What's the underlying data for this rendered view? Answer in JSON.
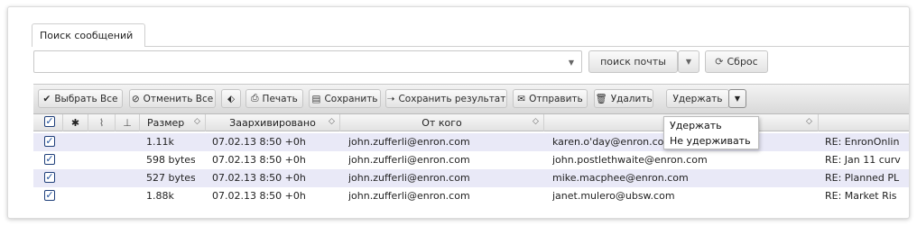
{
  "tab": {
    "label": "Поиск сообщений"
  },
  "search": {
    "value": "",
    "search_button": "поиск почты",
    "reset_button": "Сброс"
  },
  "toolbar": {
    "select_all": "Выбрать Все",
    "deselect_all": "Отменить Все",
    "print": "Печать",
    "save": "Сохранить",
    "save_result": "Сохранить результат",
    "send": "Отправить",
    "delete": "Удалить",
    "hold": "Удержать"
  },
  "dropdown": {
    "items": [
      "Удержать",
      "Не удерживать"
    ]
  },
  "columns": {
    "size": "Размер",
    "archived": "Заархивировано",
    "from": "От кого"
  },
  "rows": [
    {
      "size": "1.11k",
      "archived": "07.02.13 8:50 +0h",
      "from": "john.zufferli@enron.com",
      "to": "karen.o'day@enron.com",
      "subject": "RE: EnronOnlin",
      "checked": true
    },
    {
      "size": "598 bytes",
      "archived": "07.02.13 8:50 +0h",
      "from": "john.zufferli@enron.com",
      "to": "john.postlethwaite@enron.com",
      "subject": "RE: Jan 11 curv",
      "checked": true
    },
    {
      "size": "527 bytes",
      "archived": "07.02.13 8:50 +0h",
      "from": "john.zufferli@enron.com",
      "to": "mike.macphee@enron.com",
      "subject": "RE: Planned PL",
      "checked": true
    },
    {
      "size": "1.88k",
      "archived": "07.02.13 8:50 +0h",
      "from": "john.zufferli@enron.com",
      "to": "janet.mulero@ubsw.com",
      "subject": "RE: Market Ris",
      "checked": true
    }
  ],
  "colors": {
    "row_alt": "#e9e9f7",
    "checkbox": "#1f4f9a"
  }
}
